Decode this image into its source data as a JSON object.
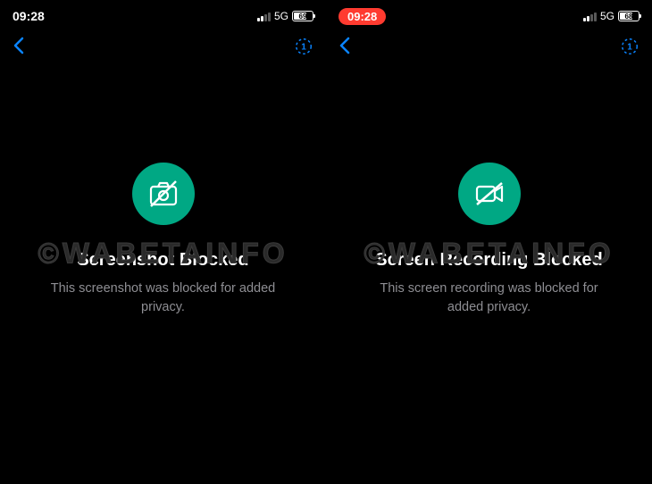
{
  "left": {
    "status": {
      "time": "09:28",
      "network": "5G",
      "battery_pct": "69",
      "battery_fill_pct": 69
    },
    "watermark": "©WABETAINFO",
    "title": "Screenshot Blocked",
    "description": "This screenshot was blocked for added privacy."
  },
  "right": {
    "status": {
      "time": "09:28",
      "network": "5G",
      "battery_pct": "68",
      "battery_fill_pct": 68
    },
    "watermark": "©WABETAINFO",
    "title": "Screen Recording Blocked",
    "description": "This screen recording was blocked for added privacy."
  }
}
